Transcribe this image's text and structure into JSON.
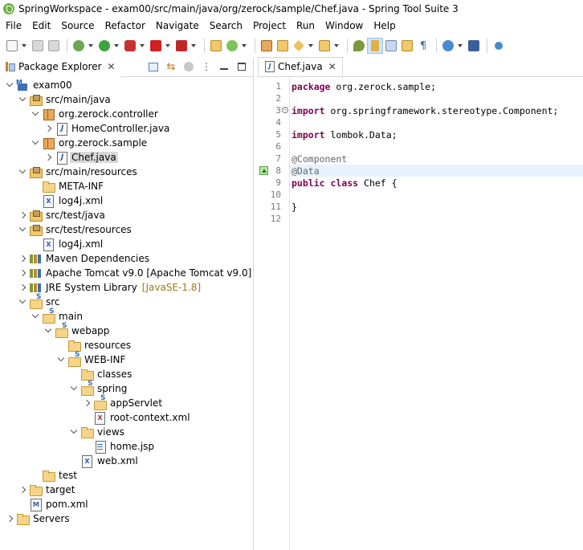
{
  "window": {
    "title": "SpringWorkspace - exam00/src/main/java/org/zerock/sample/Chef.java - Spring Tool Suite 3"
  },
  "menu": [
    "File",
    "Edit",
    "Source",
    "Refactor",
    "Navigate",
    "Search",
    "Project",
    "Run",
    "Window",
    "Help"
  ],
  "toolbar": {
    "icons": [
      "new-icon",
      "save-icon",
      "save-all-icon",
      "debug-icon",
      "run-icon",
      "run-coverage-icon",
      "stop-icon",
      "server-icon",
      "new-java-project-icon",
      "new-spring-project-icon",
      "new-package-icon",
      "new-class-icon",
      "open-type-icon",
      "search-icon",
      "toggle-mark-occurrences-icon",
      "toggle-block-selection-icon",
      "show-whitespace-icon",
      "globe-icon",
      "console-icon",
      "more-icon"
    ]
  },
  "package_explorer": {
    "tab_label": "Package Explorer",
    "close_glyph": "✕",
    "tree": [
      {
        "label": "exam00",
        "icon": "project-icon",
        "twisty": "open",
        "depth": 0
      },
      {
        "label": "src/main/java",
        "icon": "source-folder-icon",
        "twisty": "open",
        "depth": 1
      },
      {
        "label": "org.zerock.controller",
        "icon": "package-icon",
        "twisty": "open",
        "depth": 2
      },
      {
        "label": "HomeController.java",
        "icon": "java-file-icon",
        "twisty": "closed",
        "depth": 3
      },
      {
        "label": "org.zerock.sample",
        "icon": "package-icon",
        "twisty": "open",
        "depth": 2
      },
      {
        "label": "Chef.java",
        "icon": "java-file-icon",
        "twisty": "closed",
        "depth": 3,
        "selected": true
      },
      {
        "label": "src/main/resources",
        "icon": "source-folder-icon",
        "twisty": "open",
        "depth": 1
      },
      {
        "label": "META-INF",
        "icon": "folder-icon",
        "twisty": "none",
        "depth": 2
      },
      {
        "label": "log4j.xml",
        "icon": "xml-file-icon",
        "twisty": "none",
        "depth": 2
      },
      {
        "label": "src/test/java",
        "icon": "source-folder-icon",
        "twisty": "closed",
        "depth": 1
      },
      {
        "label": "src/test/resources",
        "icon": "source-folder-icon",
        "twisty": "open",
        "depth": 1
      },
      {
        "label": "log4j.xml",
        "icon": "xml-file-icon",
        "twisty": "none",
        "depth": 2
      },
      {
        "label": "Maven Dependencies",
        "icon": "library-icon",
        "twisty": "closed",
        "depth": 1
      },
      {
        "label": "Apache Tomcat v9.0 [Apache Tomcat v9.0]",
        "icon": "library-icon",
        "twisty": "closed",
        "depth": 1
      },
      {
        "label": "JRE System Library",
        "icon": "library-icon",
        "twisty": "closed",
        "depth": 1,
        "decoration": "[JavaSE-1.8]"
      },
      {
        "label": "src",
        "icon": "spring-folder-icon",
        "twisty": "open",
        "depth": 1
      },
      {
        "label": "main",
        "icon": "spring-folder-icon",
        "twisty": "open",
        "depth": 2
      },
      {
        "label": "webapp",
        "icon": "spring-folder-icon",
        "twisty": "open",
        "depth": 3
      },
      {
        "label": "resources",
        "icon": "folder-icon",
        "twisty": "none",
        "depth": 4
      },
      {
        "label": "WEB-INF",
        "icon": "spring-folder-icon",
        "twisty": "open",
        "depth": 4
      },
      {
        "label": "classes",
        "icon": "folder-icon",
        "twisty": "none",
        "depth": 5
      },
      {
        "label": "spring",
        "icon": "spring-folder-icon",
        "twisty": "open",
        "depth": 5
      },
      {
        "label": "appServlet",
        "icon": "spring-folder-icon",
        "twisty": "closed",
        "depth": 6
      },
      {
        "label": "root-context.xml",
        "icon": "spring-xml-file-icon",
        "twisty": "none",
        "depth": 6
      },
      {
        "label": "views",
        "icon": "folder-icon",
        "twisty": "open",
        "depth": 5
      },
      {
        "label": "home.jsp",
        "icon": "jsp-file-icon",
        "twisty": "none",
        "depth": 6
      },
      {
        "label": "web.xml",
        "icon": "xml-file-icon",
        "twisty": "none",
        "depth": 5
      },
      {
        "label": "test",
        "icon": "folder-icon",
        "twisty": "none",
        "depth": 2
      },
      {
        "label": "target",
        "icon": "folder-icon",
        "twisty": "closed",
        "depth": 1
      },
      {
        "label": "pom.xml",
        "icon": "pom-file-icon",
        "twisty": "none",
        "depth": 1
      },
      {
        "label": "Servers",
        "icon": "folder-icon",
        "twisty": "closed",
        "depth": 0
      }
    ]
  },
  "editor": {
    "tab_label": "Chef.java",
    "close_glyph": "✕",
    "lines": [
      {
        "num": "1",
        "tokens": [
          {
            "t": "package",
            "c": "kw"
          },
          {
            "t": " org.zerock.sample;",
            "c": ""
          }
        ]
      },
      {
        "num": "2",
        "tokens": []
      },
      {
        "num": "3",
        "fold": true,
        "tokens": [
          {
            "t": "import",
            "c": "kw"
          },
          {
            "t": " org.springframework.stereotype.Component;",
            "c": ""
          }
        ]
      },
      {
        "num": "4",
        "tokens": []
      },
      {
        "num": "5",
        "tokens": [
          {
            "t": "import",
            "c": "kw"
          },
          {
            "t": " lombok.Data;",
            "c": ""
          }
        ]
      },
      {
        "num": "6",
        "tokens": []
      },
      {
        "num": "7",
        "tokens": [
          {
            "t": "@Component",
            "c": "ann"
          }
        ]
      },
      {
        "num": "8",
        "current": true,
        "marker": true,
        "tokens": [
          {
            "t": "@Data",
            "c": "ann"
          }
        ]
      },
      {
        "num": "9",
        "tokens": [
          {
            "t": "public",
            "c": "kw"
          },
          {
            "t": " ",
            "c": ""
          },
          {
            "t": "class",
            "c": "kw"
          },
          {
            "t": " Chef {",
            "c": ""
          }
        ]
      },
      {
        "num": "10",
        "tokens": []
      },
      {
        "num": "11",
        "tokens": [
          {
            "t": "}",
            "c": ""
          }
        ]
      },
      {
        "num": "12",
        "tokens": []
      }
    ]
  },
  "colors": {
    "keyword": "#7f0055",
    "annotation": "#646464",
    "current_line": "#e8f2fe",
    "selection": "#d9d9d9",
    "decoration": "#9c7c1c"
  }
}
